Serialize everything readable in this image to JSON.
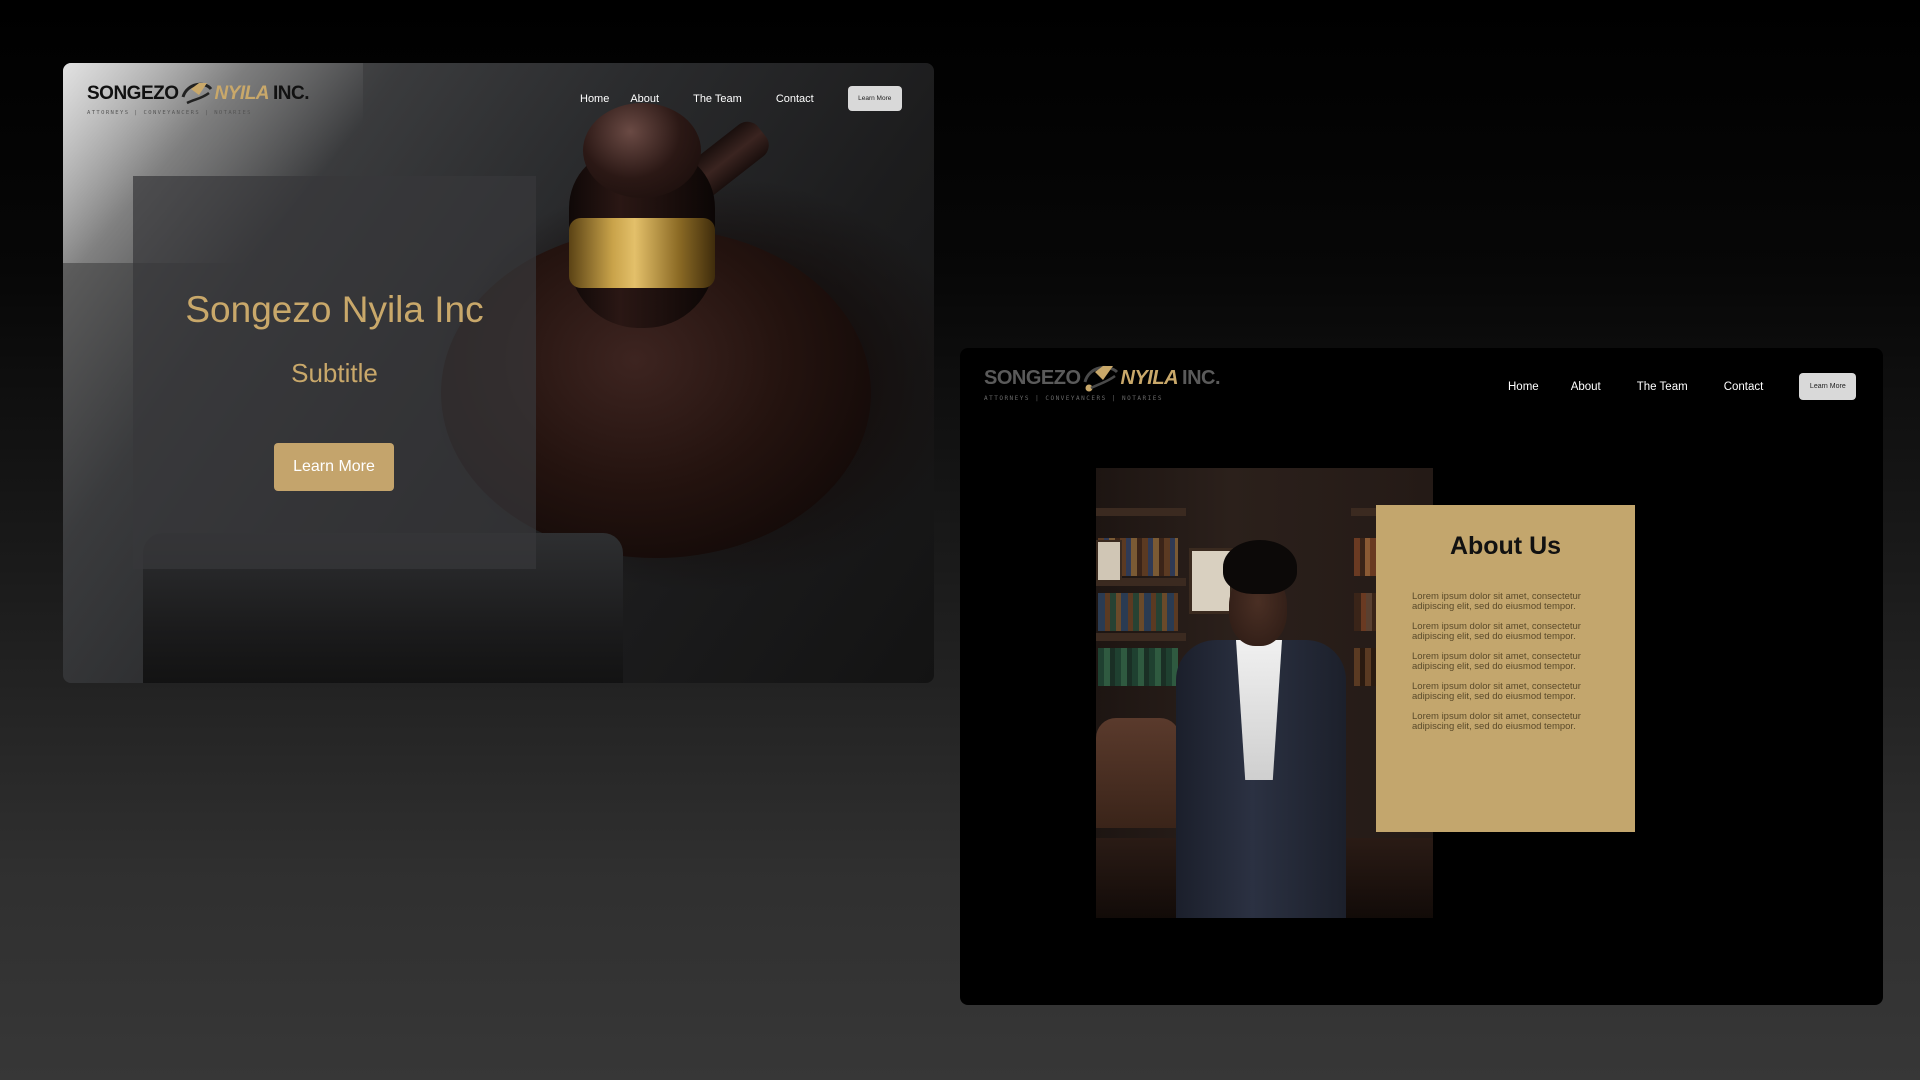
{
  "colors": {
    "gold": "#c9a86a",
    "card_gold": "#c3a66d",
    "button_gold": "#c4a46c",
    "nav_button_bg": "#d9d9d9",
    "panel_black": "#000000"
  },
  "logo": {
    "word1": "SONGEZO",
    "word2": "NYILA",
    "word3": "INC.",
    "tagline": "ATTORNEYS | CONVEYANCERS | NOTARIES",
    "mark_icon": "scales-swoosh-icon"
  },
  "hero": {
    "nav": {
      "items": [
        "Home",
        "About",
        "The Team",
        "Contact"
      ],
      "cta_label": "Learn More"
    },
    "title": "Songezo Nyila Inc",
    "subtitle": "Subtitle",
    "cta_label": "Learn More",
    "background_icon": "gavel-photo"
  },
  "about": {
    "nav": {
      "items": [
        "Home",
        "About",
        "The Team",
        "Contact"
      ],
      "cta_label": "Learn More"
    },
    "title": "About Us",
    "paragraphs": [
      [
        "Lorem ipsum dolor sit amet, consectetur",
        "adipiscing elit, sed do eiusmod tempor."
      ],
      [
        "Lorem ipsum dolor sit amet, consectetur",
        "adipiscing elit, sed do eiusmod tempor."
      ],
      [
        "Lorem ipsum dolor sit amet, consectetur",
        "adipiscing elit, sed do eiusmod tempor."
      ],
      [
        "Lorem ipsum dolor sit amet, consectetur",
        "adipiscing elit, sed do eiusmod tempor."
      ],
      [
        "Lorem ipsum dolor sit amet, consectetur",
        "adipiscing elit, sed do eiusmod tempor."
      ]
    ],
    "portrait_icon": "attorney-portrait-photo"
  }
}
